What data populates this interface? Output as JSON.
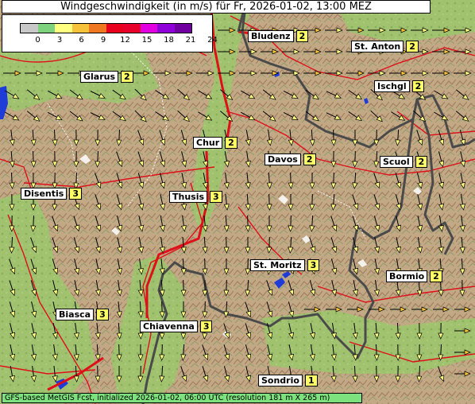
{
  "title": "Windgeschwindigkeit (in m/s) für Fr, 2026-01-02, 13:00 MEZ",
  "footer": "GFS-based MetGIS Fcst, initialized 2026-01-02, 06:00 UTC  (resolution 181 m X 265 m)",
  "scale": {
    "ticks": [
      "0",
      "3",
      "6",
      "9",
      "12",
      "15",
      "18",
      "21",
      "24"
    ],
    "colors": [
      "#c8c8c8",
      "#7ed27e",
      "#ffff80",
      "#f5c23a",
      "#f07820",
      "#e8001c",
      "#e8002a",
      "#e000e0",
      "#9000d8",
      "#7000a0"
    ]
  },
  "places": [
    {
      "name": "Bludenz",
      "value": "2"
    },
    {
      "name": "St. Anton",
      "value": "2"
    },
    {
      "name": "Glarus",
      "value": "2"
    },
    {
      "name": "Ischgl",
      "value": "2"
    },
    {
      "name": "Chur",
      "value": "2"
    },
    {
      "name": "Davos",
      "value": "2"
    },
    {
      "name": "Scuol",
      "value": "2"
    },
    {
      "name": "Disentis",
      "value": "3"
    },
    {
      "name": "Thusis",
      "value": "3"
    },
    {
      "name": "St. Moritz",
      "value": "3"
    },
    {
      "name": "Bormio",
      "value": "2"
    },
    {
      "name": "Biasca",
      "value": "3"
    },
    {
      "name": "Chiavenna",
      "value": "3"
    },
    {
      "name": "Sondrio",
      "value": "1"
    }
  ]
}
